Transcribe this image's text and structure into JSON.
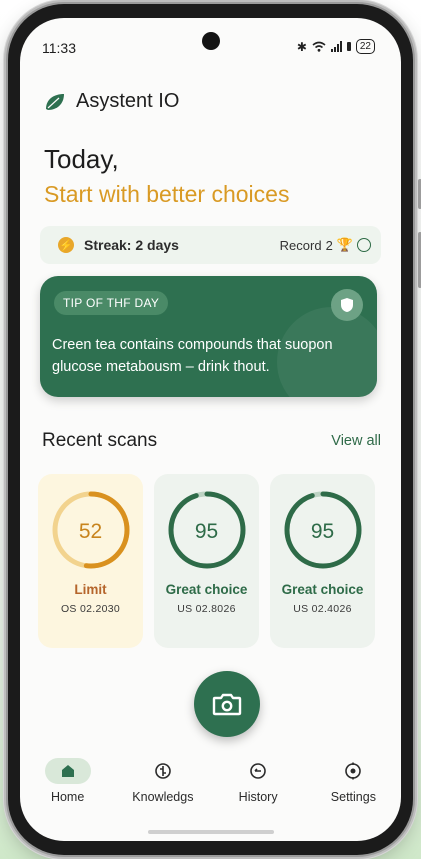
{
  "status": {
    "time": "11:33",
    "battery": "22",
    "icons": [
      "bluetooth-icon",
      "wifi-icon",
      "signal-icon",
      "battery-icon"
    ]
  },
  "app": {
    "name": "Asystent IO",
    "logo_icon": "leaf-icon"
  },
  "greeting": {
    "line1": "Today,",
    "line2": "Start with better choices"
  },
  "streak": {
    "label": "Streak: 2 days",
    "record_label": "Record",
    "record_value": "2",
    "icon": "bolt-icon"
  },
  "tip": {
    "badge": "TIP OF THF DAY",
    "text": "Creen tea contains compounds that suopon glucose metabousm – drink thout.",
    "icon": "shield-icon"
  },
  "recent": {
    "title": "Recent scans",
    "view_all": "View all",
    "cards": [
      {
        "score": "52",
        "verdict": "Limit",
        "code": "OS 02.2030",
        "progress": 0.52,
        "accent": "#d9911f",
        "bg": "#fdf6df",
        "track": "#f2d38e",
        "score_color": "#c8841d",
        "verdict_color": "#b5652b"
      },
      {
        "score": "95",
        "verdict": "Great choice",
        "code": "US 02.8026",
        "progress": 0.95,
        "accent": "#2e6b48",
        "bg": "#eef3ee",
        "track": "#bdd3c3",
        "score_color": "#2e6b48",
        "verdict_color": "#2e6b48"
      },
      {
        "score": "95",
        "verdict": "Great choice",
        "code": "US 02.4026",
        "progress": 0.95,
        "accent": "#2e6b48",
        "bg": "#eef3ee",
        "track": "#bdd3c3",
        "score_color": "#2e6b48",
        "verdict_color": "#2e6b48"
      }
    ]
  },
  "fab": {
    "icon": "camera-icon"
  },
  "nav": [
    {
      "label": "Home",
      "icon": "home-icon",
      "active": true
    },
    {
      "label": "Knowledgs",
      "icon": "knowledge-icon",
      "active": false
    },
    {
      "label": "History",
      "icon": "history-icon",
      "active": false
    },
    {
      "label": "Settings",
      "icon": "settings-icon",
      "active": false
    }
  ],
  "colors": {
    "primary": "#2e7050",
    "accent": "#d99a24"
  }
}
